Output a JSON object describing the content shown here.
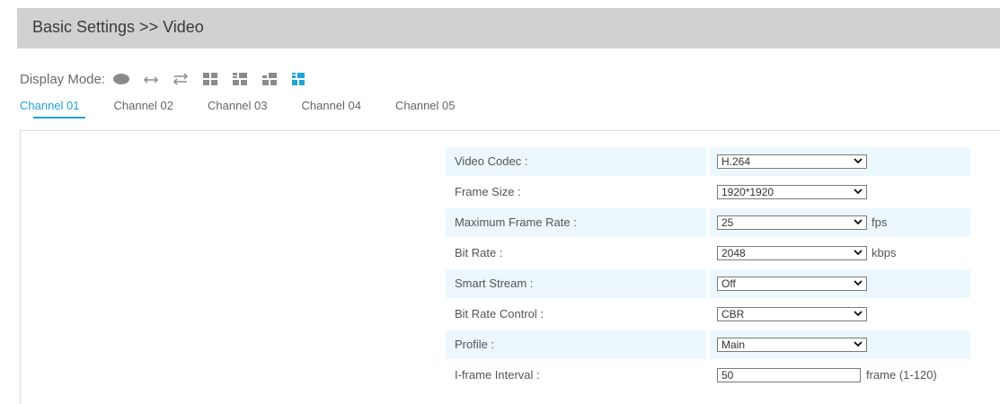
{
  "header": {
    "title": "Basic Settings >> Video"
  },
  "display_mode": {
    "label": "Display Mode:",
    "icons": [
      "ellipse-icon",
      "arrows-horizontal-icon",
      "swap-arrows-icon",
      "grid-2x2-icon",
      "grid-layout-2-icon",
      "grid-layout-3-icon",
      "grid-layout-4-icon"
    ],
    "active_index": 6,
    "accent": "#1fa3d8"
  },
  "tabs": [
    {
      "label": "Channel 01",
      "active": true
    },
    {
      "label": "Channel 02",
      "active": false
    },
    {
      "label": "Channel 03",
      "active": false
    },
    {
      "label": "Channel 04",
      "active": false
    },
    {
      "label": "Channel 05",
      "active": false
    }
  ],
  "settings": [
    {
      "label": "Video Codec :",
      "value": "H.264",
      "type": "select",
      "unit": ""
    },
    {
      "label": "Frame Size :",
      "value": "1920*1920",
      "type": "select",
      "unit": ""
    },
    {
      "label": "Maximum Frame Rate :",
      "value": "25",
      "type": "select",
      "unit": "fps"
    },
    {
      "label": "Bit Rate :",
      "value": "2048",
      "type": "select",
      "unit": "kbps"
    },
    {
      "label": "Smart Stream :",
      "value": "Off",
      "type": "select",
      "unit": ""
    },
    {
      "label": "Bit Rate Control :",
      "value": "CBR",
      "type": "select",
      "unit": ""
    },
    {
      "label": "Profile :",
      "value": "Main",
      "type": "select",
      "unit": ""
    },
    {
      "label": "I-frame Interval :",
      "value": "50",
      "type": "text",
      "unit": "frame (1-120)"
    }
  ],
  "colors": {
    "header_bg": "#d1d1d1",
    "row_shade": "#ecf8fd",
    "accent": "#1fa3d8"
  }
}
